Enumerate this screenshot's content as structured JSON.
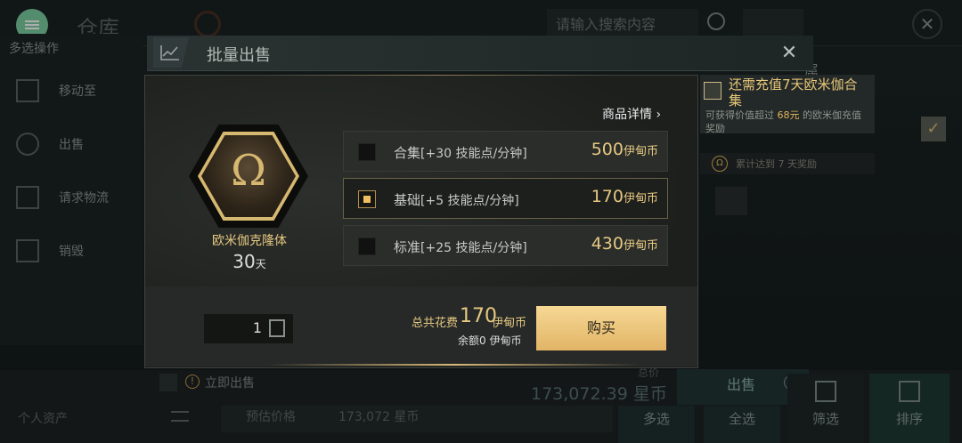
{
  "topbar": {
    "title": "仓库",
    "search_placeholder": "请输入搜索内容"
  },
  "sidebar": {
    "header": "多选操作",
    "items": [
      {
        "label": "移动至",
        "icon": "move-icon"
      },
      {
        "label": "出售",
        "icon": "sell-icon"
      },
      {
        "label": "请求物流",
        "icon": "logistics-icon"
      },
      {
        "label": "销毁",
        "icon": "destroy-icon"
      }
    ]
  },
  "right_panel": {
    "title_fragment": "属",
    "promo_title": "还需充值7天欧米伽合集",
    "promo_sub_pre": "可获得价值超过",
    "promo_sub_amount": "68元",
    "promo_sub_post": "的欧米伽充值奖励",
    "reward_text": "累计达到 7 天奖励",
    "omega_symbol": "Ω"
  },
  "bottom": {
    "sell_now_label": "立即出售",
    "total_label": "总价",
    "total_value": "173,072.39 星币",
    "sell_button": "出售",
    "estimate_label": "预估价格",
    "estimate_value": "173,072 星币",
    "assets_label": "个人资产",
    "multi_select": "多选",
    "select_all": "全选",
    "filter": "筛选",
    "sort": "排序"
  },
  "dialog": {
    "title": "批量出售",
    "close": "✕",
    "details_link": "商品详情",
    "item": {
      "name": "欧米伽克隆体",
      "days_value": "30",
      "days_unit": "天",
      "symbol": "Ω"
    },
    "options": [
      {
        "name": "合集",
        "bonus": "[+30 技能点/分钟]",
        "price": "500",
        "unit": "伊甸币",
        "selected": false
      },
      {
        "name": "基础",
        "bonus": "[+5 技能点/分钟]",
        "price": "170",
        "unit": "伊甸币",
        "selected": true
      },
      {
        "name": "标准",
        "bonus": "[+25 技能点/分钟]",
        "price": "430",
        "unit": "伊甸币",
        "selected": false
      }
    ],
    "quantity": "1",
    "cost_label": "总共花费",
    "cost_value": "170",
    "cost_unit": "伊甸币",
    "balance_text": "余额0 伊甸币",
    "buy_button": "购买"
  },
  "colors": {
    "gold": "#e6c882",
    "accent_green": "#7ccfa3",
    "buy_button": "#f0cd84"
  }
}
